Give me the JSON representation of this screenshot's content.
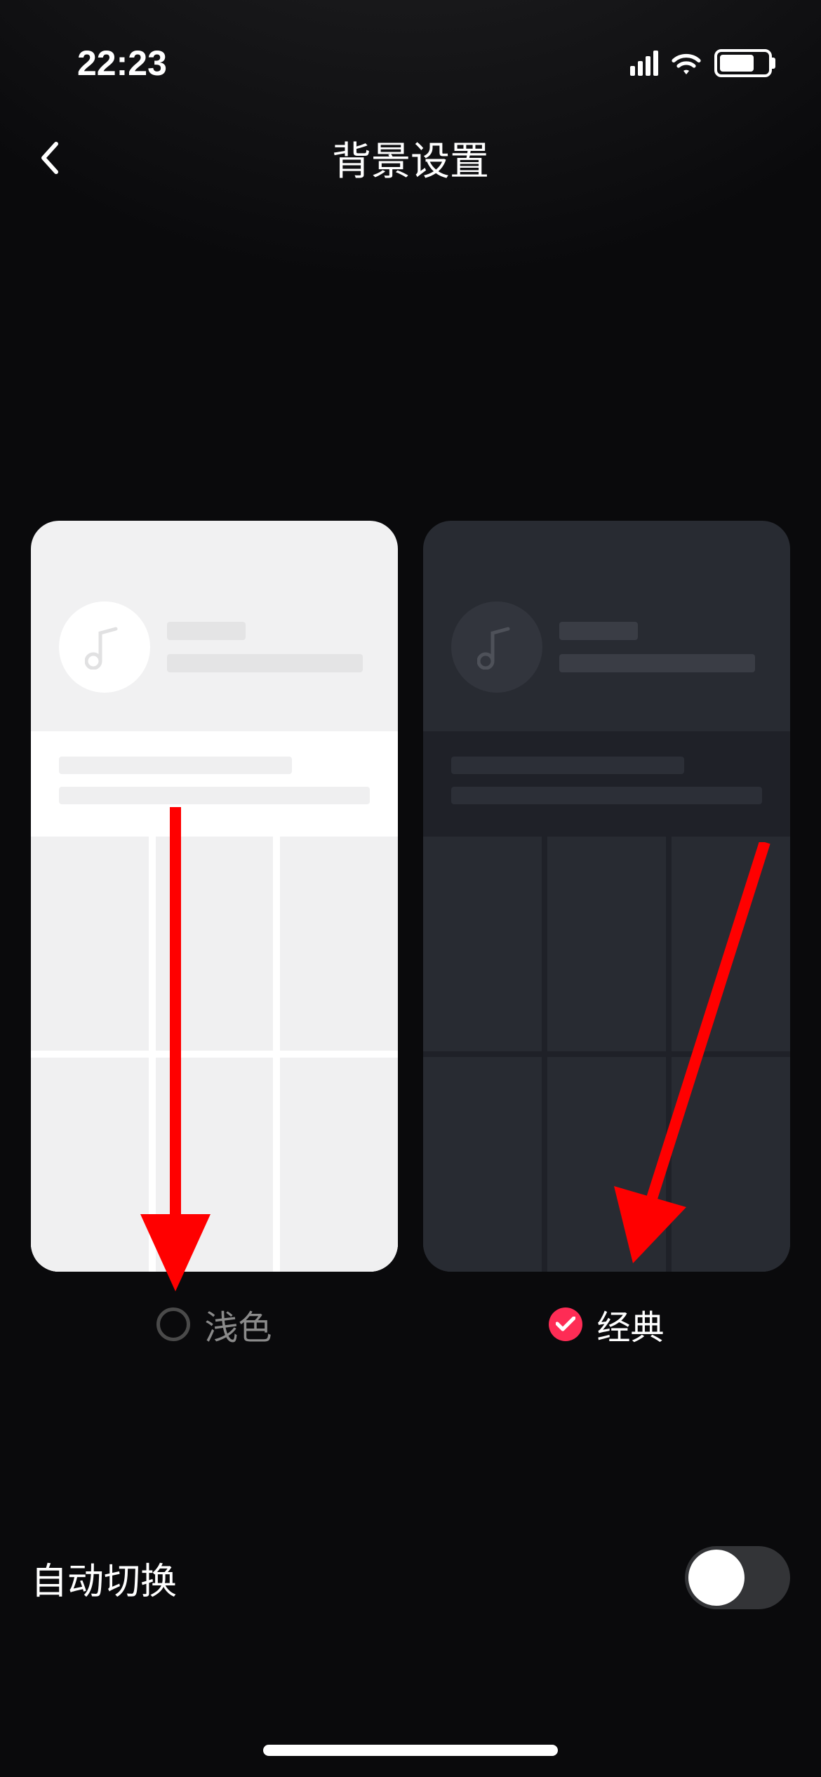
{
  "status": {
    "time": "22:23"
  },
  "header": {
    "title": "背景设置"
  },
  "themes": [
    {
      "key": "light",
      "label": "浅色",
      "selected": false
    },
    {
      "key": "classic",
      "label": "经典",
      "selected": true
    }
  ],
  "autoSwitch": {
    "label": "自动切换",
    "enabled": false
  },
  "colors": {
    "accent": "#fe2c55",
    "arrow": "#ff0000"
  }
}
